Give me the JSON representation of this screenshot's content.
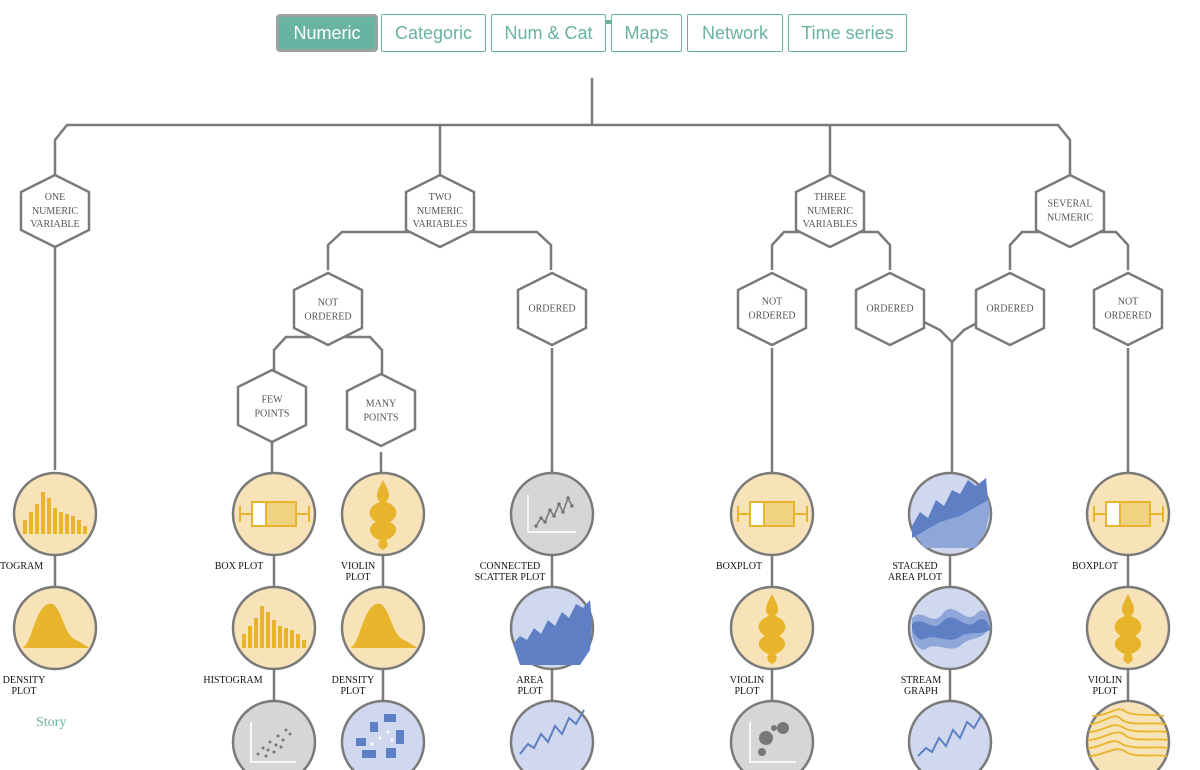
{
  "tabs": [
    {
      "label": "Numeric",
      "active": true
    },
    {
      "label": "Categoric",
      "active": false
    },
    {
      "label": "Num & Cat",
      "active": false
    },
    {
      "label": "Maps",
      "active": false
    },
    {
      "label": "Network",
      "active": false
    },
    {
      "label": "Time series",
      "active": false
    }
  ],
  "decision_nodes": {
    "one_numeric": "One numeric variable",
    "two_numeric": "Two numeric variables",
    "three_numeric": "Three numeric variables",
    "several_numeric": "Several numeric",
    "not_ordered_2": "Not ordered",
    "ordered_2": "Ordered",
    "few_points": "Few points",
    "many_points": "Many points",
    "not_ordered_3": "Not ordered",
    "ordered_3": "Ordered",
    "ordered_s": "Ordered",
    "not_ordered_s": "Not ordered"
  },
  "chart_labels": {
    "histogram_1": "TOGRAM",
    "density_1": "Density plot",
    "boxplot_2": "Box plot",
    "histogram_2": "Histogram",
    "violin_2": "Violin plot",
    "density_2": "Density plot",
    "connected_scatter": "Connected scatter plot",
    "area": "Area plot",
    "boxplot_3": "Boxplot",
    "violin_3": "Violin plot",
    "stacked_area": "Stacked area plot",
    "stream": "Stream graph",
    "boxplot_s": "Boxplot",
    "violin_s": "Violin plot"
  },
  "footer": {
    "story_link": "Story"
  },
  "colors": {
    "accent": "#69b3a2",
    "line": "#7a7a7a",
    "chart_yellow_bg": "#f7e3b7",
    "chart_yellow": "#e8b42c",
    "chart_blue_bg": "#cfd8ee",
    "chart_blue": "#5f7fc4",
    "chart_grey_bg": "#d6d6d6"
  }
}
